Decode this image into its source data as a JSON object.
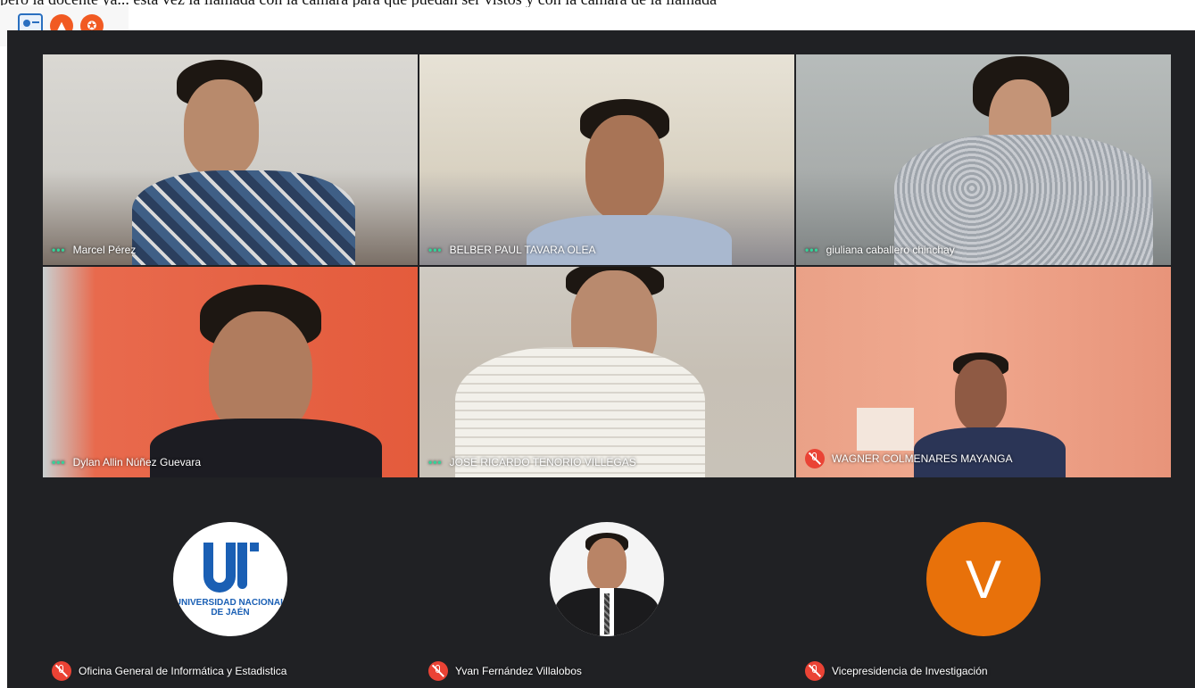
{
  "top_text": "pero la docente ya... esta vez la llamada con la cámara para que puedan ser vistos y con la cámara de la llamada",
  "toolbar": {
    "icons": [
      "presentation-icon",
      "alert-icon",
      "record-icon"
    ]
  },
  "meeting": {
    "background": "#202124",
    "video_tiles": [
      {
        "name": "Marcel Pérez",
        "status": "speaking-dots"
      },
      {
        "name": "BELBER PAUL TAVARA OLEA",
        "status": "speaking-dots"
      },
      {
        "name": "giuliana caballero chinchay",
        "status": "speaking-dots"
      },
      {
        "name": "Dylan Allin Núñez Guevara",
        "status": "speaking-dots"
      },
      {
        "name": "JOSE RICARDO TENORIO VILLEGAS",
        "status": "speaking-dots"
      },
      {
        "name": "WAGNER COLMENARES MAYANGA",
        "status": "muted"
      }
    ],
    "avatar_tiles": [
      {
        "name": "Oficina General de Informática y Estadistica",
        "status": "muted",
        "avatar": "logo",
        "logo_text_line1": "UNIVERSIDAD NACIONAL",
        "logo_text_line2": "DE JAÉN"
      },
      {
        "name": "Yvan Fernández Villalobos",
        "status": "muted",
        "avatar": "photo"
      },
      {
        "name": "Vicepresidencia de Investigación",
        "status": "muted",
        "avatar": "letter",
        "letter": "V"
      }
    ],
    "dots_glyph": "•••",
    "colors": {
      "speaking_dots": "#34d399",
      "muted_badge": "#ea4335",
      "letter_avatar": "#e8710a",
      "logo_blue": "#1a5fb4"
    }
  }
}
